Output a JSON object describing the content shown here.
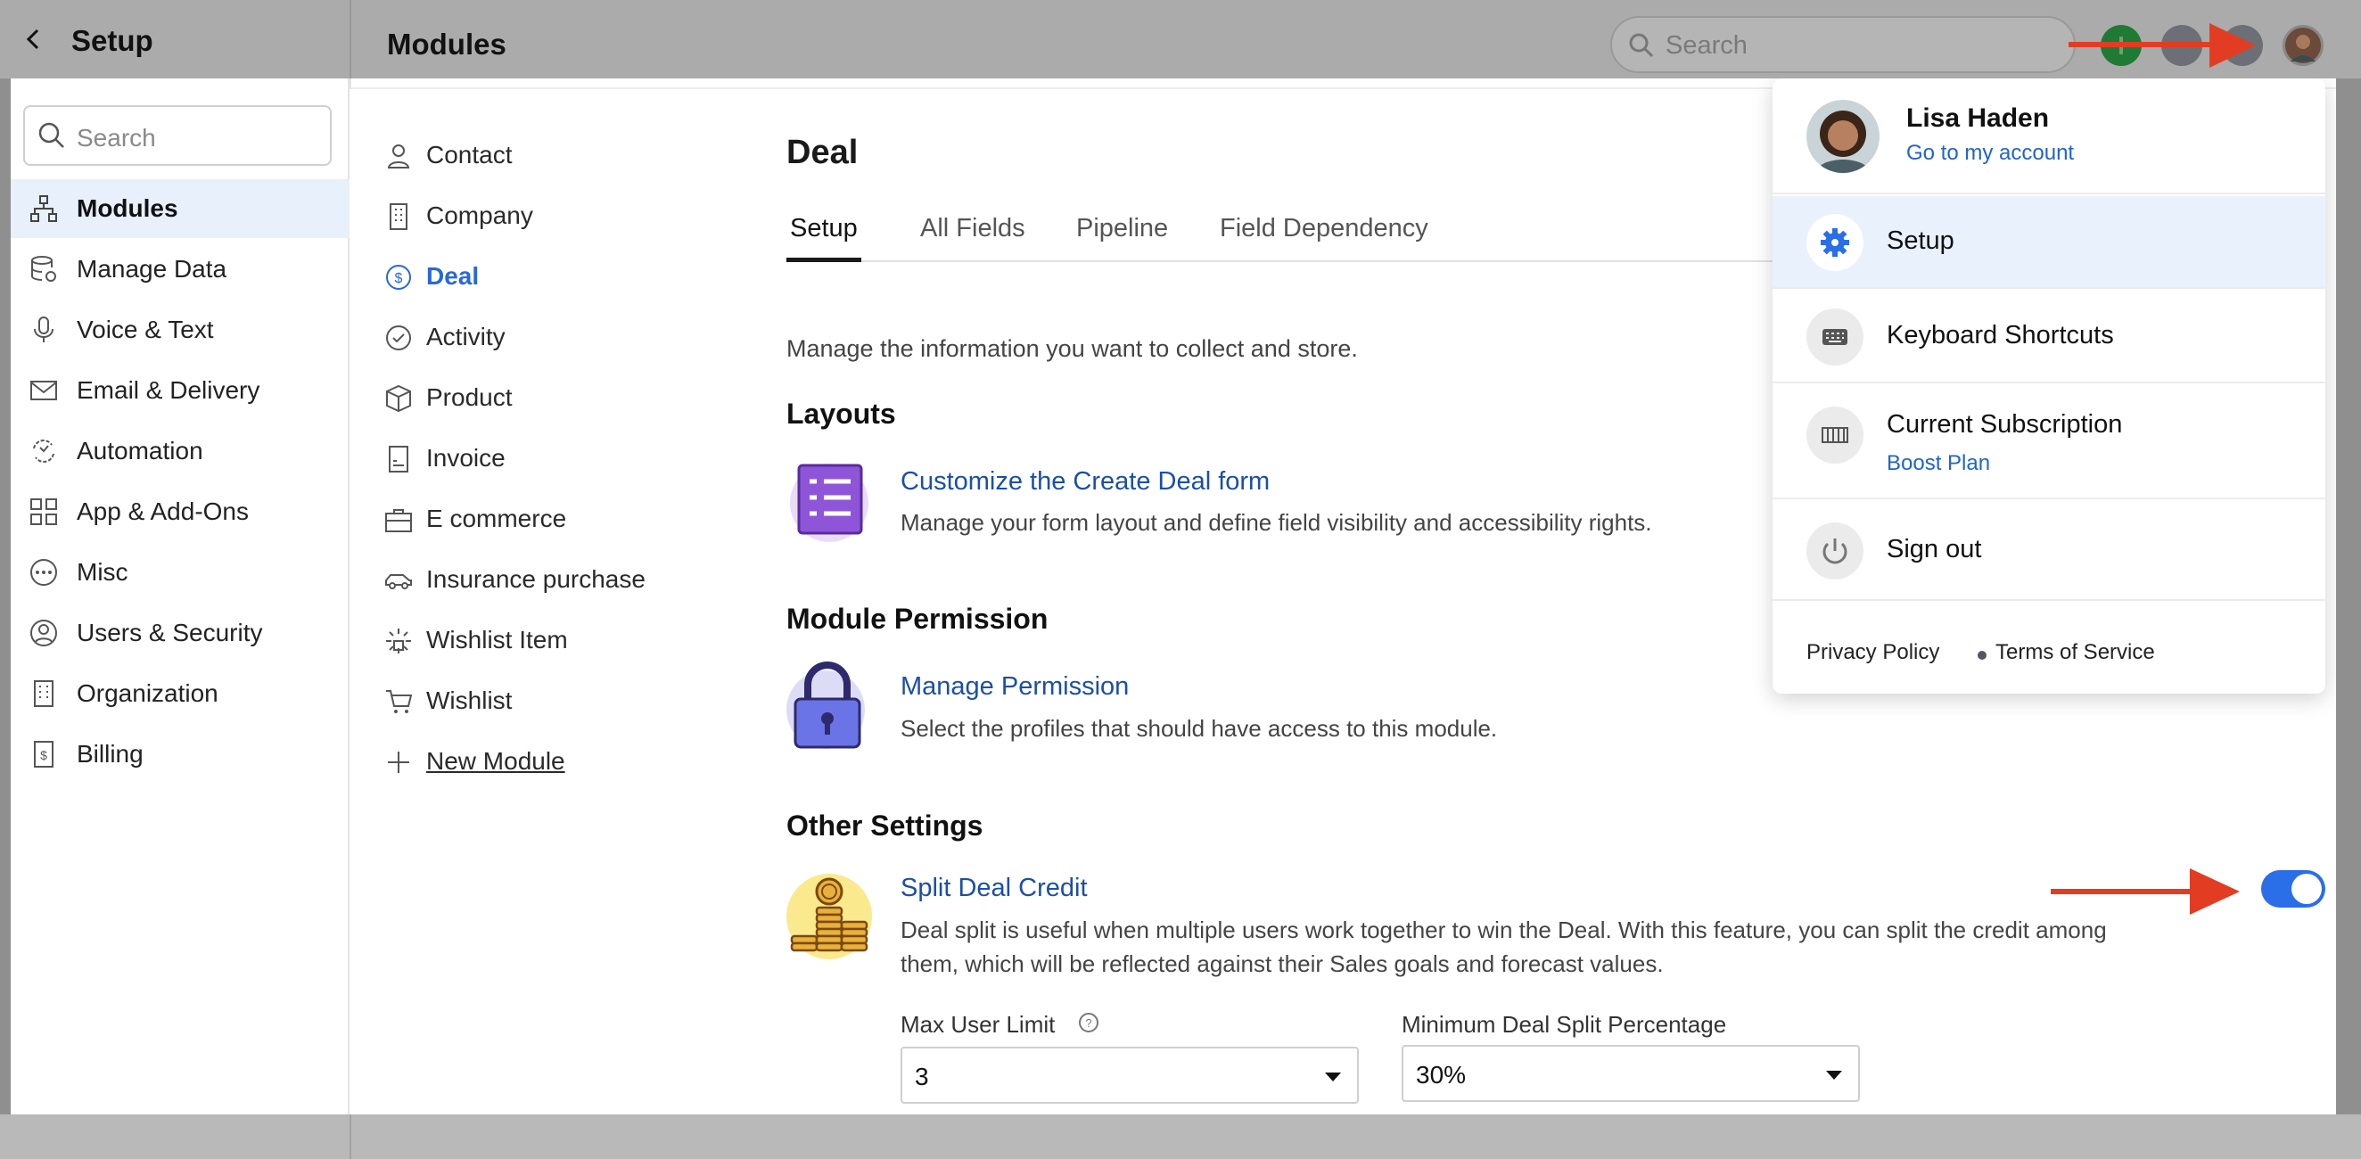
{
  "topbar": {
    "title": "Setup",
    "page_title": "Modules",
    "search_placeholder": "Search"
  },
  "sidebar": {
    "search_placeholder": "Search",
    "items": [
      {
        "label": "Modules",
        "icon": "sitemap-icon"
      },
      {
        "label": "Manage Data",
        "icon": "database-icon"
      },
      {
        "label": "Voice & Text",
        "icon": "microphone-icon"
      },
      {
        "label": "Email & Delivery",
        "icon": "envelope-icon"
      },
      {
        "label": "Automation",
        "icon": "automation-icon"
      },
      {
        "label": "App & Add-Ons",
        "icon": "grid-icon"
      },
      {
        "label": "Misc",
        "icon": "more-icon"
      },
      {
        "label": "Users & Security",
        "icon": "user-circle-icon"
      },
      {
        "label": "Organization",
        "icon": "building-icon"
      },
      {
        "label": "Billing",
        "icon": "billing-icon"
      }
    ]
  },
  "modules": {
    "items": [
      {
        "label": "Contact",
        "icon": "person-icon"
      },
      {
        "label": "Company",
        "icon": "building-icon"
      },
      {
        "label": "Deal",
        "icon": "dollar-icon"
      },
      {
        "label": "Activity",
        "icon": "check-circle-icon"
      },
      {
        "label": "Product",
        "icon": "box-icon"
      },
      {
        "label": "Invoice",
        "icon": "invoice-icon"
      },
      {
        "label": "E commerce",
        "icon": "briefcase-icon"
      },
      {
        "label": "Insurance purchase",
        "icon": "car-icon"
      },
      {
        "label": "Wishlist Item",
        "icon": "sparkle-icon"
      },
      {
        "label": "Wishlist",
        "icon": "cart-icon"
      }
    ],
    "new_module": "New Module"
  },
  "deal": {
    "title": "Deal",
    "tabs": [
      "Setup",
      "All Fields",
      "Pipeline",
      "Field Dependency"
    ],
    "description": "Manage the information you want to collect and store.",
    "layouts": {
      "heading": "Layouts",
      "link": "Customize the Create Deal form",
      "sub": "Manage your form layout and define field visibility and accessibility rights."
    },
    "permission": {
      "heading": "Module Permission",
      "link": "Manage Permission",
      "sub": "Select the profiles that should have access to this module."
    },
    "other": {
      "heading": "Other Settings",
      "link": "Split Deal Credit",
      "sub_line1": "Deal split is useful when multiple users work together to win the Deal. With this feature, you can split the credit among",
      "sub_line2": "them, which will be reflected against their Sales goals and forecast values.",
      "toggle_on": true,
      "max_user_label": "Max User Limit",
      "max_user_value": "3",
      "min_split_label": "Minimum Deal Split Percentage",
      "min_split_value": "30%"
    }
  },
  "dropdown": {
    "user_name": "Lisa Haden",
    "account_link": "Go to my account",
    "setup": "Setup",
    "shortcuts": "Keyboard Shortcuts",
    "subscription": "Current Subscription",
    "plan": "Boost Plan",
    "signout": "Sign out",
    "privacy": "Privacy Policy",
    "terms": "Terms of Service"
  },
  "colors": {
    "accent": "#2968d8",
    "link": "#1b4fa8",
    "arrow": "#e23d22"
  }
}
